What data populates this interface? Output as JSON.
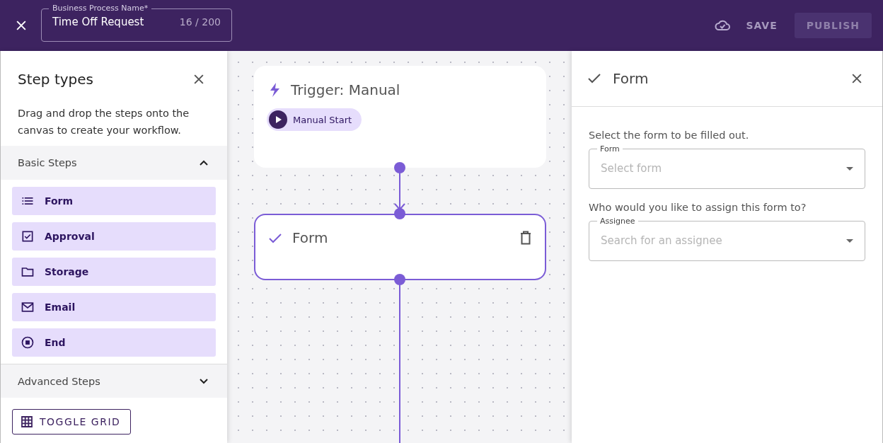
{
  "header": {
    "name_field": {
      "label": "Business Process Name*",
      "value": "Time Off Request",
      "counter": "16 / 200"
    },
    "save": "SAVE",
    "publish": {
      "label": "PUBLISH",
      "disabled": true
    }
  },
  "step_panel": {
    "title": "Step types",
    "description": "Drag and drop the steps onto the canvas to create your workflow.",
    "sections": [
      {
        "title": "Basic Steps",
        "expanded": true,
        "items": [
          {
            "label": "Form",
            "kind": "list"
          },
          {
            "label": "Approval",
            "kind": "checkbox"
          },
          {
            "label": "Storage",
            "kind": "folder"
          },
          {
            "label": "Email",
            "kind": "mail"
          },
          {
            "label": "End",
            "kind": "stop"
          }
        ]
      },
      {
        "title": "Advanced Steps",
        "expanded": false
      }
    ],
    "toggle_grid": "TOGGLE GRID"
  },
  "canvas": {
    "nodes": [
      {
        "kind": "trigger",
        "title": "Trigger: Manual",
        "chip": "Manual Start",
        "selected": false
      },
      {
        "kind": "form",
        "title": "Form",
        "selected": true
      }
    ]
  },
  "detail_panel": {
    "title": "Form",
    "fields": [
      {
        "prompt": "Select the form to be filled out.",
        "label": "Form",
        "placeholder": "Select form"
      },
      {
        "prompt": "Who would you like to assign this form to?",
        "label": "Assignee",
        "placeholder": "Search for an assignee"
      }
    ]
  }
}
